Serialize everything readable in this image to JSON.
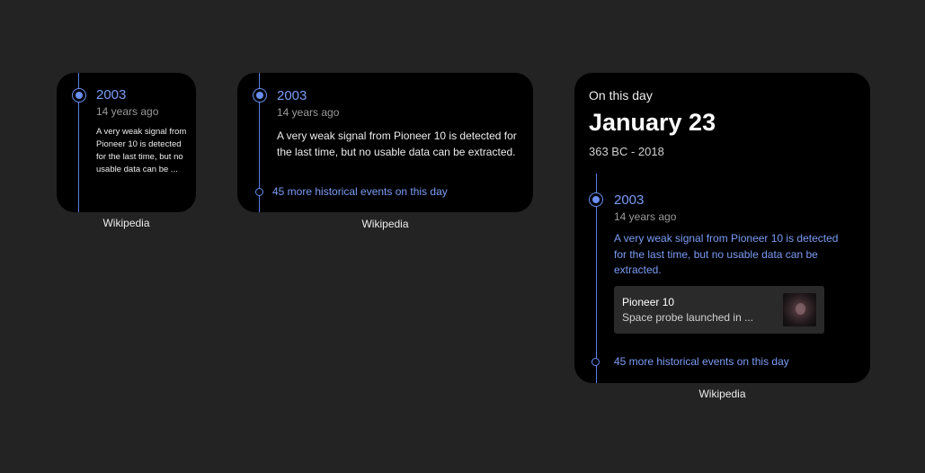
{
  "small": {
    "year": "2003",
    "ago": "14 years ago",
    "text": "A very weak signal from Pioneer 10 is detected for the last time, but no usable data can be ...",
    "caption": "Wikipedia"
  },
  "medium": {
    "year": "2003",
    "ago": "14 years ago",
    "text": "A very weak signal from Pioneer 10 is detected for the last time, but no usable data can be extracted.",
    "more": "45 more historical events on this day",
    "caption": "Wikipedia"
  },
  "large": {
    "header": "On this day",
    "date": "January 23",
    "range": "363 BC - 2018",
    "year": "2003",
    "ago": "14 years ago",
    "text": "A very weak signal from Pioneer 10 is detected for the last time, but no usable data can be extracted.",
    "card": {
      "title": "Pioneer 10",
      "subtitle": "Space probe launched in ..."
    },
    "more": "45 more historical events on this day",
    "caption": "Wikipedia"
  },
  "colors": {
    "background": "#232323",
    "widget": "#000000",
    "accent": "#7b9cf5"
  }
}
